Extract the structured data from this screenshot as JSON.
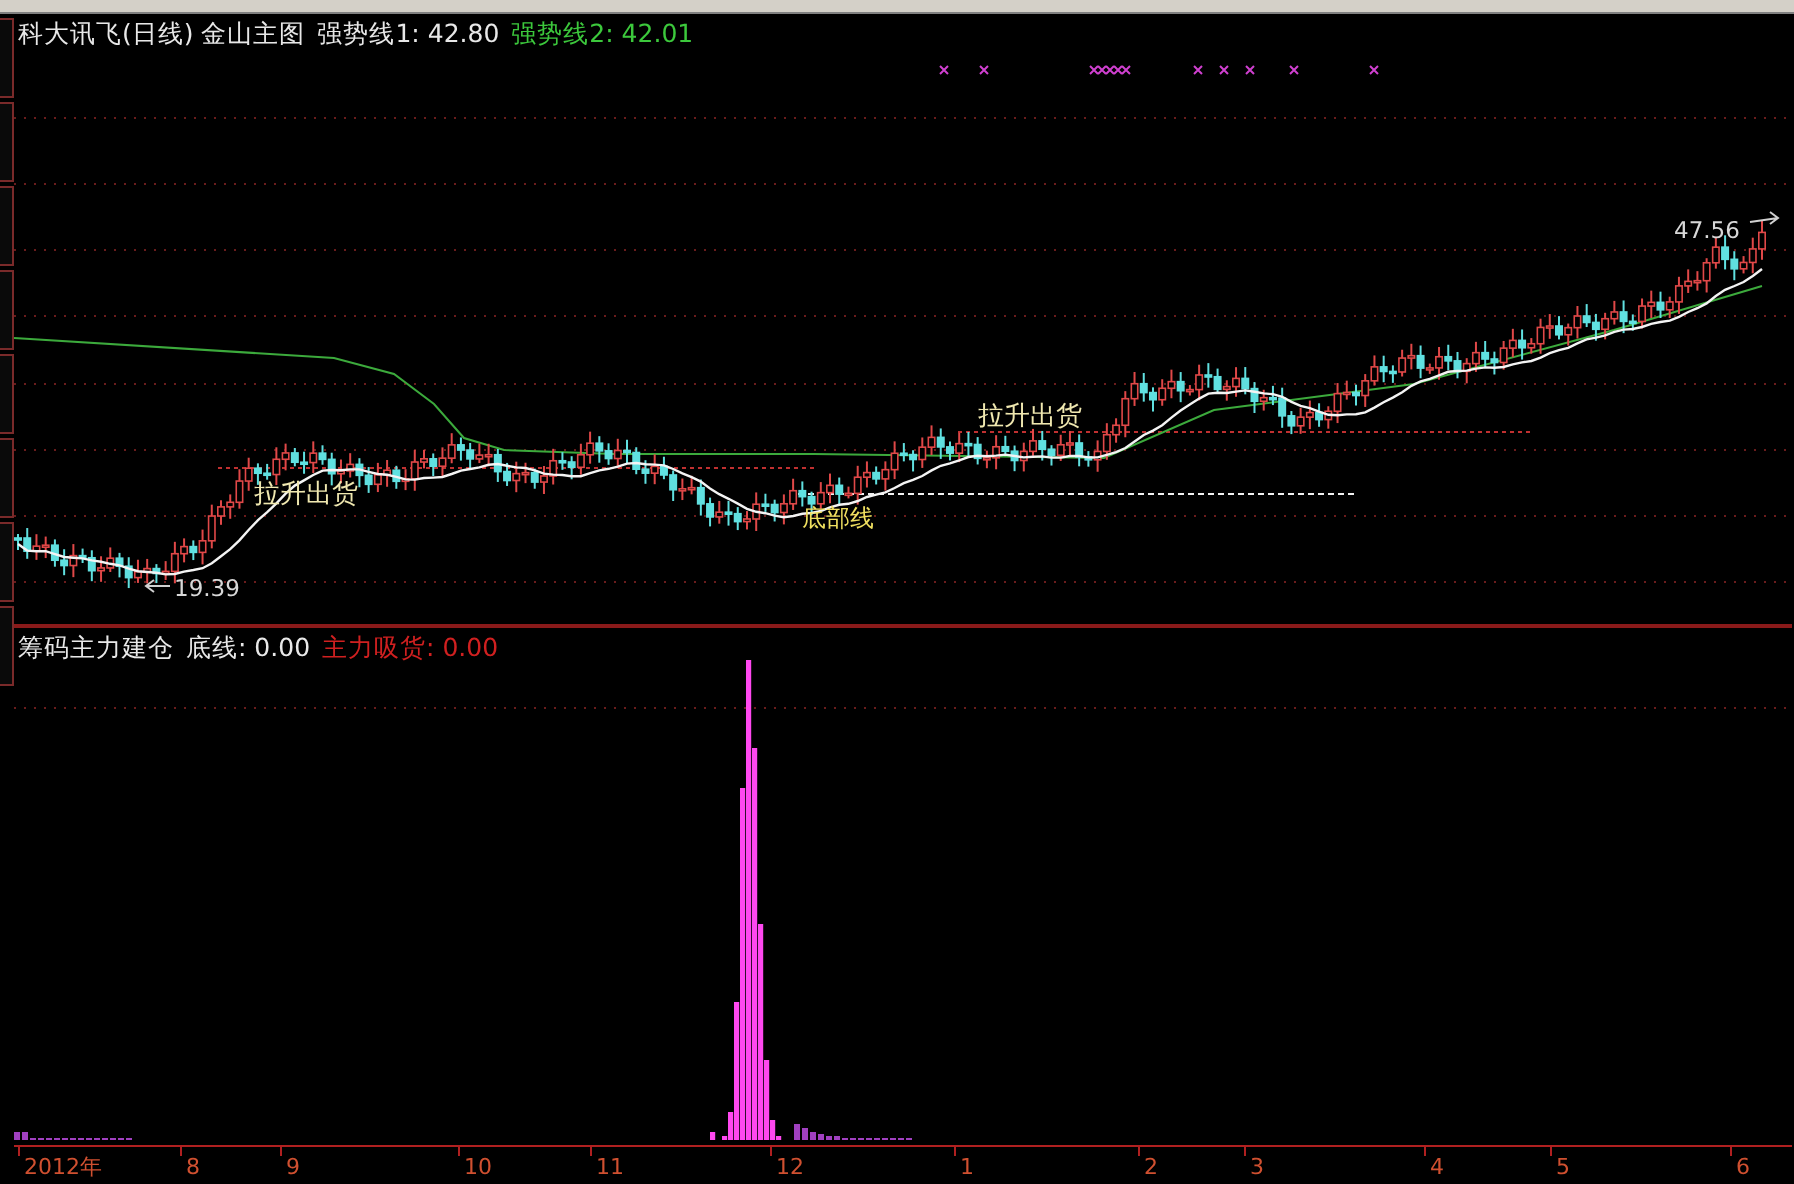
{
  "header": {
    "title": "科大讯飞(日线) 金山主图",
    "indicators": [
      {
        "label": "强势线1: 42.80",
        "color": "#e8e8e8"
      },
      {
        "label": "强势线2: 42.01",
        "color": "#3cc83c"
      }
    ]
  },
  "main_chart": {
    "annotations": [
      {
        "kind": "signal",
        "label": "拉升出货"
      },
      {
        "kind": "level",
        "label": "底部线"
      },
      {
        "kind": "signal",
        "label": "拉升出货"
      },
      {
        "kind": "low",
        "label": "19.39"
      },
      {
        "kind": "high",
        "label": "47.56"
      }
    ]
  },
  "indicator_panel": {
    "title": "筹码主力建仓",
    "values": [
      {
        "label": "底线: 0.00",
        "color": "#e8e8e8"
      },
      {
        "label": "主力吸货: 0.00",
        "color": "#d02020"
      }
    ]
  },
  "time_axis": {
    "labels": [
      "2012年",
      "8",
      "9",
      "10",
      "11",
      "12",
      "1",
      "2",
      "3",
      "4",
      "5",
      "6"
    ]
  }
}
